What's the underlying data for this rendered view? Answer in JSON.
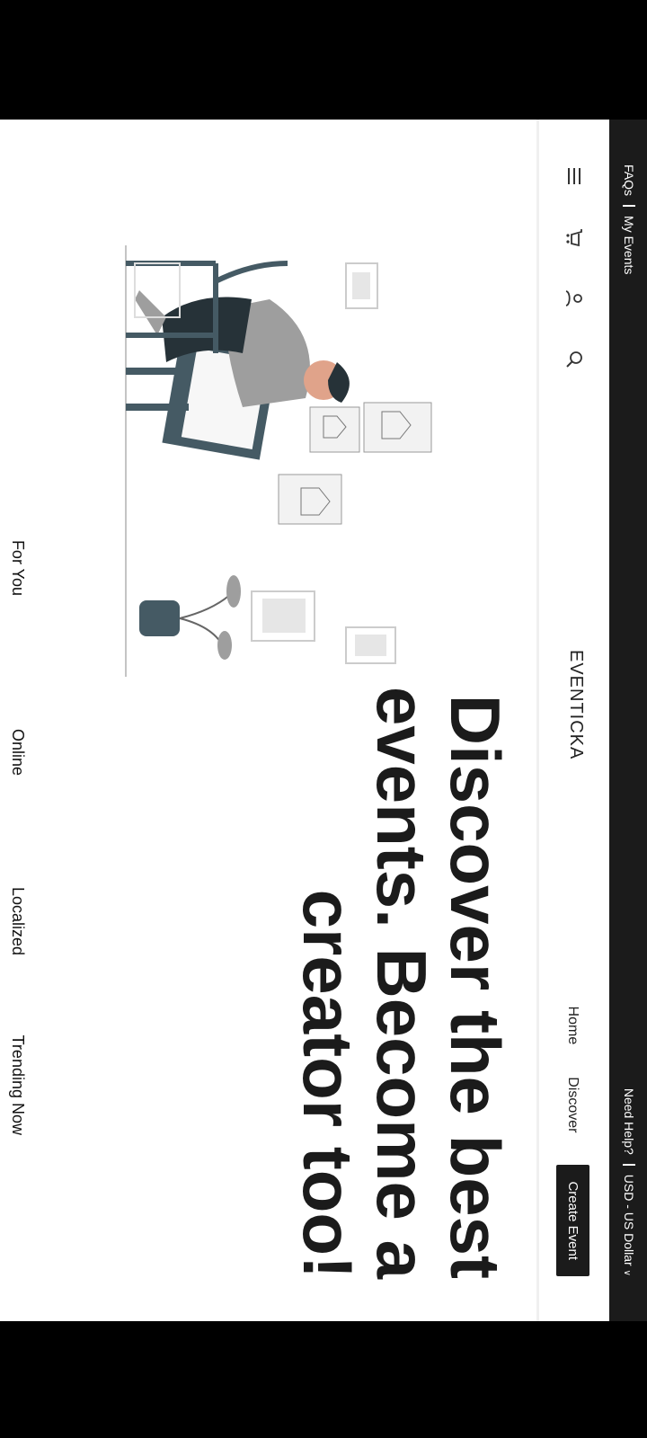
{
  "topbar": {
    "currency": "USD - US Dollar",
    "help": "Need Help?",
    "my_events": "My Events",
    "faqs": "FAQs"
  },
  "nav": {
    "logo": "EVENTICKA",
    "links": {
      "home": "Home",
      "discover": "Discover"
    },
    "create_event": "Create Event",
    "icons": [
      "menu-icon",
      "cart-icon",
      "user-icon",
      "search-icon"
    ]
  },
  "hero": {
    "title": "Discover the best events. Become a creator too!"
  },
  "tabs": [
    "Trending Now",
    "Localized",
    "Online",
    "For You"
  ],
  "colors": {
    "dark": "#1b1b1b",
    "accent": "#455a64",
    "gray": "#9e9e9e"
  }
}
